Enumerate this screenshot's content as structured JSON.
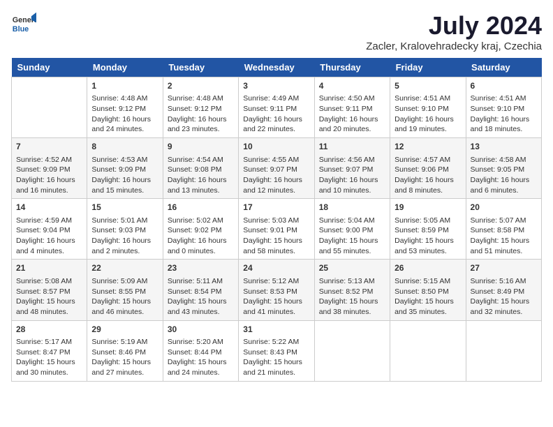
{
  "logo": {
    "general": "General",
    "blue": "Blue"
  },
  "title": "July 2024",
  "subtitle": "Zacler, Kralovehradecky kraj, Czechia",
  "header_days": [
    "Sunday",
    "Monday",
    "Tuesday",
    "Wednesday",
    "Thursday",
    "Friday",
    "Saturday"
  ],
  "weeks": [
    [
      {
        "day": "",
        "info": ""
      },
      {
        "day": "1",
        "info": "Sunrise: 4:48 AM\nSunset: 9:12 PM\nDaylight: 16 hours\nand 24 minutes."
      },
      {
        "day": "2",
        "info": "Sunrise: 4:48 AM\nSunset: 9:12 PM\nDaylight: 16 hours\nand 23 minutes."
      },
      {
        "day": "3",
        "info": "Sunrise: 4:49 AM\nSunset: 9:11 PM\nDaylight: 16 hours\nand 22 minutes."
      },
      {
        "day": "4",
        "info": "Sunrise: 4:50 AM\nSunset: 9:11 PM\nDaylight: 16 hours\nand 20 minutes."
      },
      {
        "day": "5",
        "info": "Sunrise: 4:51 AM\nSunset: 9:10 PM\nDaylight: 16 hours\nand 19 minutes."
      },
      {
        "day": "6",
        "info": "Sunrise: 4:51 AM\nSunset: 9:10 PM\nDaylight: 16 hours\nand 18 minutes."
      }
    ],
    [
      {
        "day": "7",
        "info": "Sunrise: 4:52 AM\nSunset: 9:09 PM\nDaylight: 16 hours\nand 16 minutes."
      },
      {
        "day": "8",
        "info": "Sunrise: 4:53 AM\nSunset: 9:09 PM\nDaylight: 16 hours\nand 15 minutes."
      },
      {
        "day": "9",
        "info": "Sunrise: 4:54 AM\nSunset: 9:08 PM\nDaylight: 16 hours\nand 13 minutes."
      },
      {
        "day": "10",
        "info": "Sunrise: 4:55 AM\nSunset: 9:07 PM\nDaylight: 16 hours\nand 12 minutes."
      },
      {
        "day": "11",
        "info": "Sunrise: 4:56 AM\nSunset: 9:07 PM\nDaylight: 16 hours\nand 10 minutes."
      },
      {
        "day": "12",
        "info": "Sunrise: 4:57 AM\nSunset: 9:06 PM\nDaylight: 16 hours\nand 8 minutes."
      },
      {
        "day": "13",
        "info": "Sunrise: 4:58 AM\nSunset: 9:05 PM\nDaylight: 16 hours\nand 6 minutes."
      }
    ],
    [
      {
        "day": "14",
        "info": "Sunrise: 4:59 AM\nSunset: 9:04 PM\nDaylight: 16 hours\nand 4 minutes."
      },
      {
        "day": "15",
        "info": "Sunrise: 5:01 AM\nSunset: 9:03 PM\nDaylight: 16 hours\nand 2 minutes."
      },
      {
        "day": "16",
        "info": "Sunrise: 5:02 AM\nSunset: 9:02 PM\nDaylight: 16 hours\nand 0 minutes."
      },
      {
        "day": "17",
        "info": "Sunrise: 5:03 AM\nSunset: 9:01 PM\nDaylight: 15 hours\nand 58 minutes."
      },
      {
        "day": "18",
        "info": "Sunrise: 5:04 AM\nSunset: 9:00 PM\nDaylight: 15 hours\nand 55 minutes."
      },
      {
        "day": "19",
        "info": "Sunrise: 5:05 AM\nSunset: 8:59 PM\nDaylight: 15 hours\nand 53 minutes."
      },
      {
        "day": "20",
        "info": "Sunrise: 5:07 AM\nSunset: 8:58 PM\nDaylight: 15 hours\nand 51 minutes."
      }
    ],
    [
      {
        "day": "21",
        "info": "Sunrise: 5:08 AM\nSunset: 8:57 PM\nDaylight: 15 hours\nand 48 minutes."
      },
      {
        "day": "22",
        "info": "Sunrise: 5:09 AM\nSunset: 8:55 PM\nDaylight: 15 hours\nand 46 minutes."
      },
      {
        "day": "23",
        "info": "Sunrise: 5:11 AM\nSunset: 8:54 PM\nDaylight: 15 hours\nand 43 minutes."
      },
      {
        "day": "24",
        "info": "Sunrise: 5:12 AM\nSunset: 8:53 PM\nDaylight: 15 hours\nand 41 minutes."
      },
      {
        "day": "25",
        "info": "Sunrise: 5:13 AM\nSunset: 8:52 PM\nDaylight: 15 hours\nand 38 minutes."
      },
      {
        "day": "26",
        "info": "Sunrise: 5:15 AM\nSunset: 8:50 PM\nDaylight: 15 hours\nand 35 minutes."
      },
      {
        "day": "27",
        "info": "Sunrise: 5:16 AM\nSunset: 8:49 PM\nDaylight: 15 hours\nand 32 minutes."
      }
    ],
    [
      {
        "day": "28",
        "info": "Sunrise: 5:17 AM\nSunset: 8:47 PM\nDaylight: 15 hours\nand 30 minutes."
      },
      {
        "day": "29",
        "info": "Sunrise: 5:19 AM\nSunset: 8:46 PM\nDaylight: 15 hours\nand 27 minutes."
      },
      {
        "day": "30",
        "info": "Sunrise: 5:20 AM\nSunset: 8:44 PM\nDaylight: 15 hours\nand 24 minutes."
      },
      {
        "day": "31",
        "info": "Sunrise: 5:22 AM\nSunset: 8:43 PM\nDaylight: 15 hours\nand 21 minutes."
      },
      {
        "day": "",
        "info": ""
      },
      {
        "day": "",
        "info": ""
      },
      {
        "day": "",
        "info": ""
      }
    ]
  ]
}
